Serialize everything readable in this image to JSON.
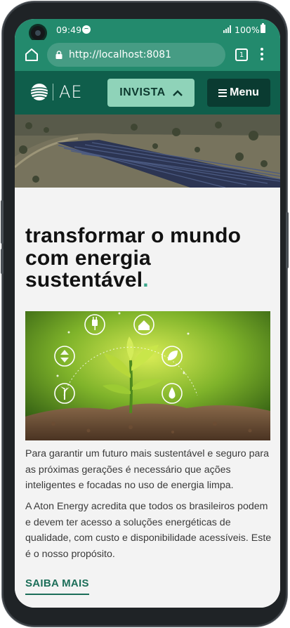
{
  "status_bar": {
    "time": "09:49",
    "battery": "100%"
  },
  "browser": {
    "url": "http://localhost:8081",
    "tab_count": "1"
  },
  "header": {
    "logo_text": "AE",
    "invest_label": "INVISTA",
    "menu_label": "Menu"
  },
  "main": {
    "headline_text": "transformar o mundo com energia sustentável",
    "headline_period": ".",
    "paragraph_1": "Para garantir um futuro mais sustentável e seguro para as próximas gerações é necessário que ações inteligentes e focadas no uso de energia limpa.",
    "paragraph_2": "A Aton Energy acredita que todos os brasileiros podem e devem ter acesso a soluções energéticas de qualidade, com custo e disponibilidade acessíveis. Este é o nosso propósito.",
    "cta_label": "SAIBA MAIS"
  },
  "icons": [
    "home-icon",
    "lock-icon",
    "tabs-icon",
    "more-icon",
    "chevron-up-icon",
    "hamburger-icon",
    "plug-icon",
    "house-icon",
    "leaf-icon",
    "water-drop-icon",
    "wind-turbine-icon",
    "recycle-icon"
  ],
  "colors": {
    "status_bar": "#238a6d",
    "header_bg": "#0f5e4b",
    "invest_button": "#8fd3b9",
    "menu_button": "#0a3b31",
    "accent": "#3aa58a",
    "link": "#1c6e59"
  }
}
